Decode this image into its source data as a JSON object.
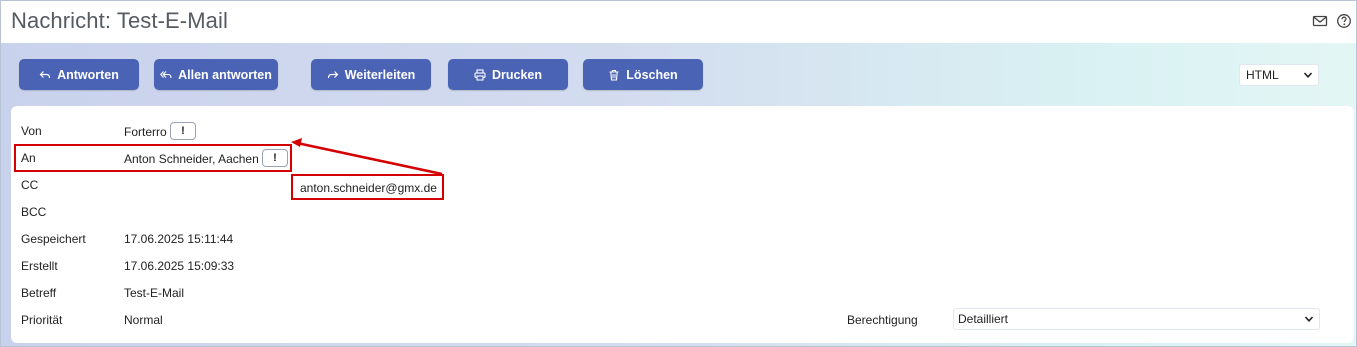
{
  "window": {
    "title": "Nachricht: Test-E-Mail",
    "icons": [
      "mail-icon",
      "help-icon"
    ]
  },
  "toolbar": {
    "buttons": [
      {
        "label": "Antworten",
        "icon": "reply-icon"
      },
      {
        "label": "Allen antworten",
        "icon": "reply-all-icon"
      },
      {
        "label": "Weiterleiten",
        "icon": "forward-icon"
      },
      {
        "label": "Drucken",
        "icon": "print-icon"
      },
      {
        "label": "Löschen",
        "icon": "trash-icon"
      }
    ],
    "format_select": "HTML"
  },
  "details": {
    "von_label": "Von",
    "von_value": "Forterro",
    "an_label": "An",
    "an_value": "Anton Schneider, Aachen",
    "cc_label": "CC",
    "bcc_label": "BCC",
    "gespeichert_label": "Gespeichert",
    "gespeichert_value": "17.06.2025 15:11:44",
    "erstellt_label": "Erstellt",
    "erstellt_value": "17.06.2025 15:09:33",
    "betreff_label": "Betreff",
    "betreff_value": "Test-E-Mail",
    "prioritaet_label": "Priorität",
    "prioritaet_value": "Normal",
    "berechtigung_label": "Berechtigung",
    "berechtigung_value": "Detailliert",
    "info_button_label": "!",
    "email_tooltip": "anton.schneider@gmx.de"
  },
  "colors": {
    "button_bg": "#4b63b5",
    "highlight": "#d40000",
    "band_start": "#c9d2ec",
    "band_end": "#e3f6f4"
  }
}
